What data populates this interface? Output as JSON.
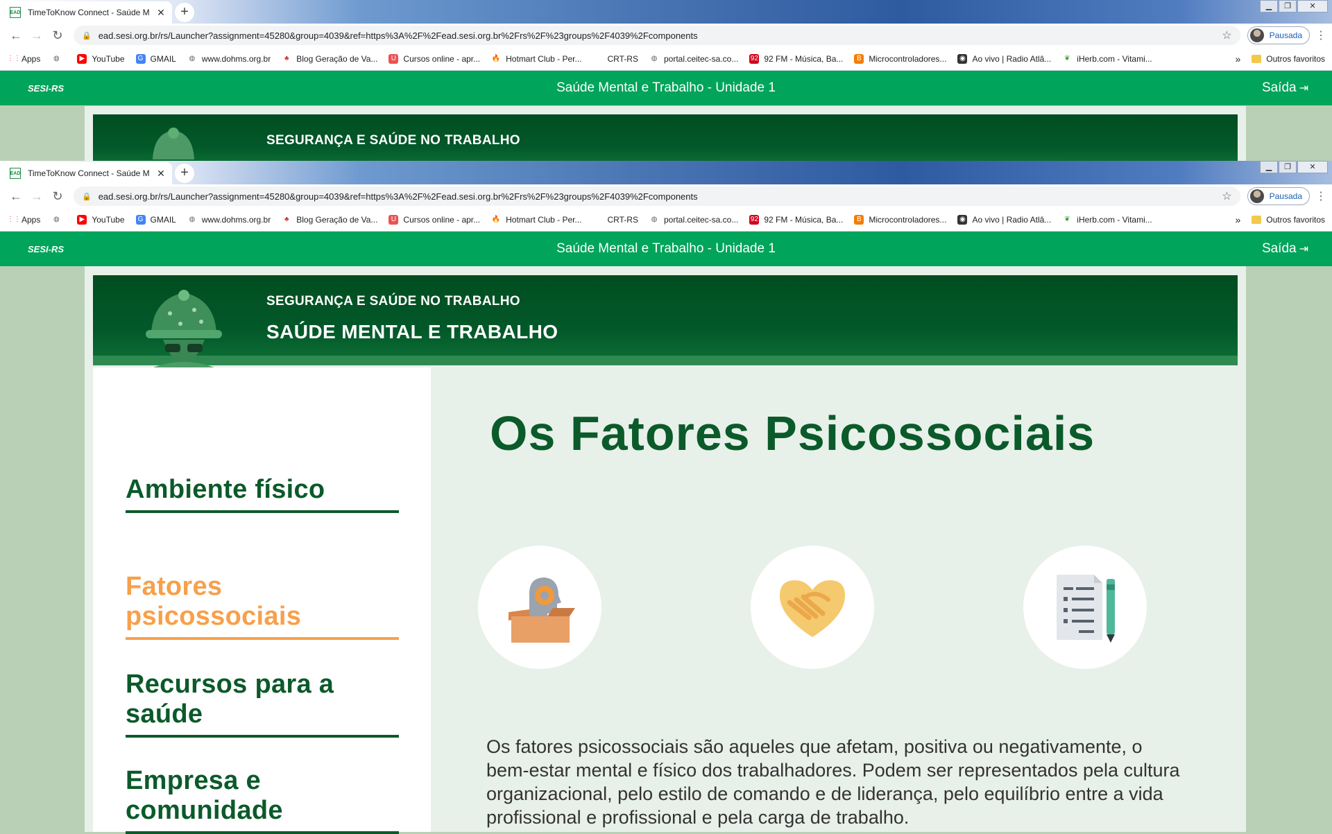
{
  "browser": {
    "tab_title": "TimeToKnow Connect - Saúde M",
    "tab_favicon": "EAD",
    "url": "ead.sesi.org.br/rs/Launcher?assignment=45280&group=4039&ref=https%3A%2F%2Fead.sesi.org.br%2Frs%2F%23groups%2F4039%2Fcomponents",
    "profile_label": "Pausada",
    "bookmarks": [
      {
        "label": "Apps",
        "icon": "apps-grid-icon",
        "color": "#e8453c"
      },
      {
        "label": "",
        "icon": "globe-icon",
        "color": "#5f6368"
      },
      {
        "label": "YouTube",
        "icon": "youtube-icon",
        "color": "#ff0000"
      },
      {
        "label": "GMAIL",
        "icon": "google-icon",
        "color": "#4285f4"
      },
      {
        "label": "www.dohms.org.br",
        "icon": "globe-icon",
        "color": "#5f6368"
      },
      {
        "label": "Blog Geração de Va...",
        "icon": "club-icon",
        "color": "#c0392b"
      },
      {
        "label": "Cursos online - apr...",
        "icon": "udemy-icon",
        "color": "#ec5252"
      },
      {
        "label": "Hotmart Club - Per...",
        "icon": "flame-icon",
        "color": "#f04e23"
      },
      {
        "label": "CRT-RS",
        "icon": "blank-icon",
        "color": "#ffffff"
      },
      {
        "label": "portal.ceitec-sa.co...",
        "icon": "globe-icon",
        "color": "#5f6368"
      },
      {
        "label": "92 FM - Música, Ba...",
        "icon": "radio-92-icon",
        "color": "#d0021b"
      },
      {
        "label": "Microcontroladores...",
        "icon": "blogger-icon",
        "color": "#f57d00"
      },
      {
        "label": "Ao vivo | Radio Atlâ...",
        "icon": "radio-icon",
        "color": "#333333"
      },
      {
        "label": "iHerb.com - Vitami...",
        "icon": "leaf-icon",
        "color": "#3c9a32"
      }
    ],
    "other_bookmarks": "Outros favoritos"
  },
  "site": {
    "logo": "SESI-RS",
    "course_title": "Saúde Mental e Trabalho - Unidade 1",
    "exit_label": "Saída",
    "banner_kicker": "SEGURANÇA E SAÚDE NO TRABALHO",
    "banner_title": "SAÚDE MENTAL E TRABALHO"
  },
  "content": {
    "nav": [
      {
        "label": "Ambiente físico",
        "active": false
      },
      {
        "label": "Fatores psicossociais",
        "active": true
      },
      {
        "label": "Recursos para a saúde",
        "active": false
      },
      {
        "label": "Empresa e comunidade",
        "active": false
      }
    ],
    "title": "Os Fatores Psicossociais",
    "icons": [
      "head-gear-box-icon",
      "handshake-icon",
      "document-pen-icon"
    ],
    "body": "Os fatores psicossociais são aqueles que afetam, positiva ou negativamente, o bem-estar mental e físico dos trabalhadores. Podem ser representados pela cultura organizacional, pelo estilo de comando e de liderança, pelo equilíbrio entre a vida profissional e profissional e pela carga de trabalho."
  },
  "colors": {
    "site_green": "#00a45a",
    "dark_green": "#0b5a2a",
    "active_orange": "#f7a04a"
  }
}
